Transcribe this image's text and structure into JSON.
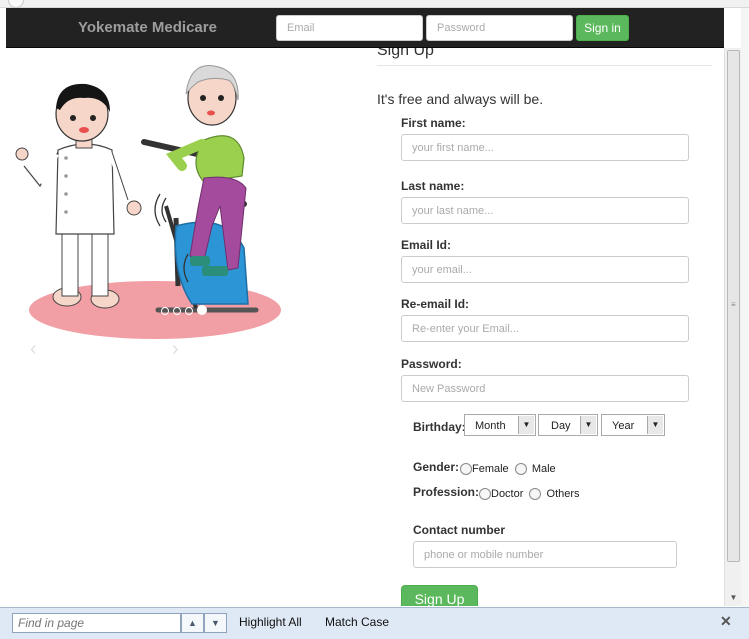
{
  "navbar": {
    "brand": "Yokemate Medicare",
    "email_placeholder": "Email",
    "password_placeholder": "Password",
    "signin_label": "Sign in"
  },
  "carousel": {
    "prev_icon": "chevron-left-icon",
    "next_icon": "chevron-right-icon",
    "slide_count": 4,
    "active_slide": 4
  },
  "signup": {
    "title": "Sign Up",
    "tagline": "It's free and always will be.",
    "fields": {
      "first_name": {
        "label": "First name:",
        "placeholder": "your first name..."
      },
      "last_name": {
        "label": "Last name:",
        "placeholder": "your last name..."
      },
      "email": {
        "label": "Email Id:",
        "placeholder": "your email..."
      },
      "reemail": {
        "label": "Re-email Id:",
        "placeholder": "Re-enter your Email..."
      },
      "password": {
        "label": "Password:",
        "placeholder": "New Password"
      },
      "contact": {
        "label": "Contact number",
        "placeholder": "phone or mobile number"
      }
    },
    "birthday": {
      "label": "Birthday:",
      "month": "Month",
      "day": "Day",
      "year": "Year"
    },
    "gender": {
      "label": "Gender:",
      "female": "Female",
      "male": "Male"
    },
    "profession": {
      "label": "Profession:",
      "doctor": "Doctor",
      "others": "Others"
    },
    "submit_label": "Sign Up"
  },
  "findbar": {
    "placeholder": "Find in page",
    "highlight_all": "Highlight All",
    "match_case": "Match Case"
  },
  "colors": {
    "navbar_bg": "#222222",
    "success": "#5cb85c",
    "floor": "#f19ea4",
    "bike": "#2b95d6",
    "shirt": "#9bd04f",
    "pants": "#a54b9e"
  }
}
